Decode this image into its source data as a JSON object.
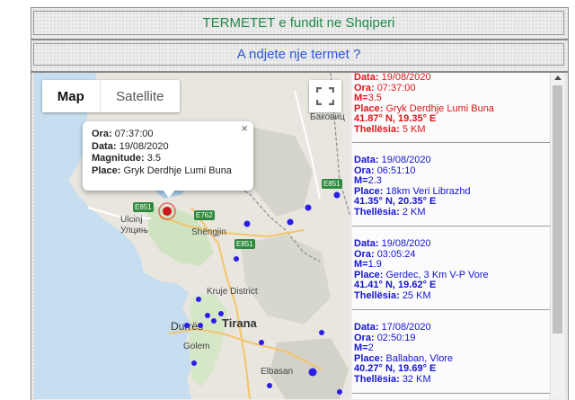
{
  "header": {
    "title": "TERMETET e fundit ne Shqiperi",
    "report_link": "A ndjete nje termet ?"
  },
  "map": {
    "tab_map": "Map",
    "tab_satellite": "Satellite",
    "fullscreen_icon": "fullscreen-icon",
    "labels": {
      "bakovic": "Баковиц",
      "ulcinj": "Ulcinj",
      "ulcinj_cyr": "Улцињ",
      "shengjin": "Shëngjin",
      "kruje": "Kruje District",
      "durres": "Durrës",
      "tirana": "Tirana",
      "golem": "Golem",
      "elbasan": "Elbasan",
      "e851a": "E851",
      "e762": "E762",
      "e851b": "E851",
      "e851c": "E851"
    },
    "popup": {
      "ora_label": "Ora:",
      "ora_value": "07:37:00",
      "data_label": "Data:",
      "data_value": "19/08/2020",
      "magnitude_label": "Magnitude:",
      "magnitude_value": "3.5",
      "place_label": "Place:",
      "place_value": "Gryk Derdhje Lumi Buna",
      "close": "×"
    },
    "colors": {
      "marker_selected": "#d0141b",
      "marker": "#2b1ee8"
    }
  },
  "list": {
    "entries": [
      {
        "data_label": "Data:",
        "data_value": "19/08/2020",
        "ora_label": "Ora:",
        "ora_value": "07:37:00",
        "m_label": "M=",
        "m_value": "3.5",
        "place_label": "Place:",
        "place_value": "Gryk Derdhje Lumi Buna",
        "coords": "41.87° N, 19.35° E",
        "depth_label": "Thellësia:",
        "depth_value": "5 KM",
        "color": "#e0161c"
      },
      {
        "data_label": "Data:",
        "data_value": "19/08/2020",
        "ora_label": "Ora:",
        "ora_value": "06:51:10",
        "m_label": "M=",
        "m_value": "2.3",
        "place_label": "Place:",
        "place_value": "18km Veri Librazhd",
        "coords": "41.35° N, 20.35° E",
        "depth_label": "Thellësia:",
        "depth_value": "2 KM",
        "color": "#1414d4"
      },
      {
        "data_label": "Data:",
        "data_value": "19/08/2020",
        "ora_label": "Ora:",
        "ora_value": "03:05:24",
        "m_label": "M=",
        "m_value": "1.9",
        "place_label": "Place:",
        "place_value": "Gerdec, 3 Km V-P Vore",
        "coords": "41.41° N, 19.62° E",
        "depth_label": "Thellësia:",
        "depth_value": "25 KM",
        "color": "#1414d4"
      },
      {
        "data_label": "Data:",
        "data_value": "17/08/2020",
        "ora_label": "Ora:",
        "ora_value": "02:50:19",
        "m_label": "M=",
        "m_value": "2",
        "place_label": "Place:",
        "place_value": "Ballaban, Vlore",
        "coords": "40.27° N, 19.69° E",
        "depth_label": "Thellësia:",
        "depth_value": "32 KM",
        "color": "#1414d4"
      }
    ]
  }
}
